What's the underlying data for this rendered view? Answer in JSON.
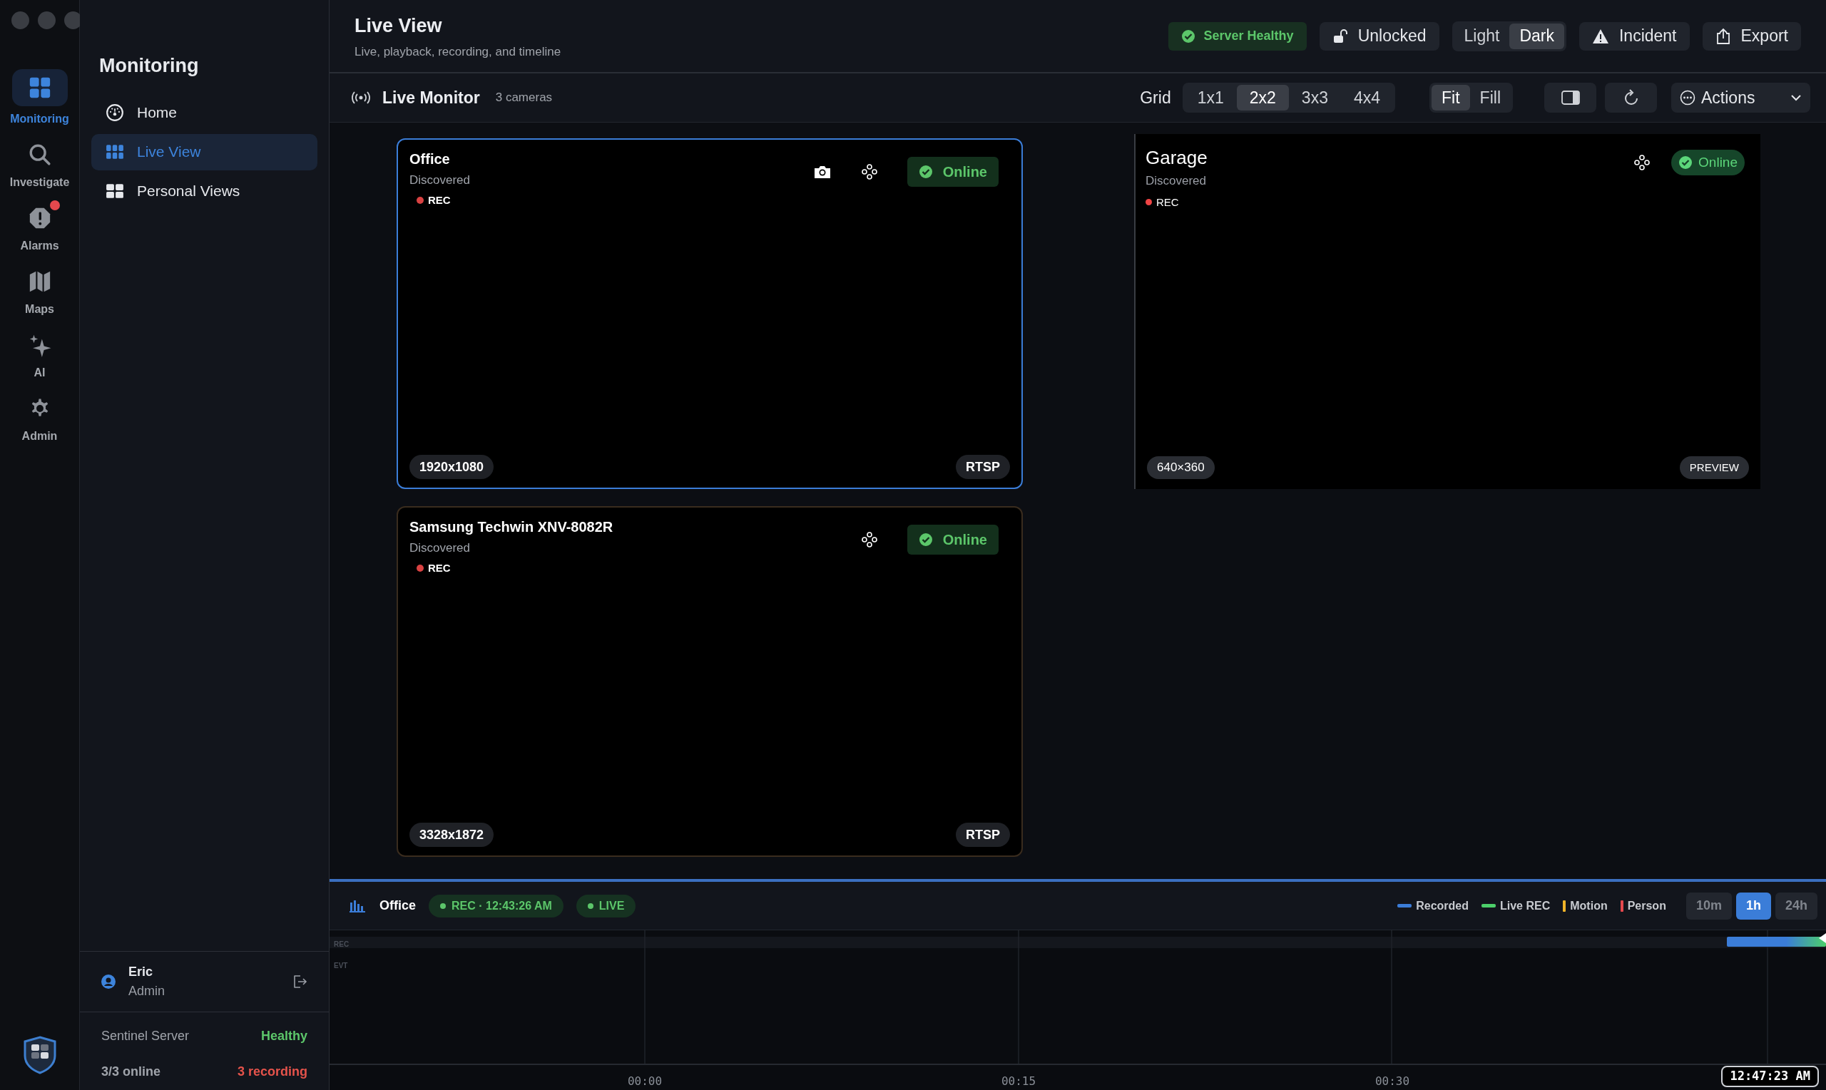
{
  "rail": [
    {
      "label": "Monitoring",
      "selected": true,
      "badge": false
    },
    {
      "label": "Investigate",
      "selected": false,
      "badge": false
    },
    {
      "label": "Alarms",
      "selected": false,
      "badge": true
    },
    {
      "label": "Maps",
      "selected": false,
      "badge": false
    },
    {
      "label": "AI",
      "selected": false,
      "badge": false
    },
    {
      "label": "Admin",
      "selected": false,
      "badge": false
    }
  ],
  "sidebar": {
    "title": "Monitoring",
    "items": [
      {
        "label": "Home",
        "selected": false
      },
      {
        "label": "Live View",
        "selected": true
      },
      {
        "label": "Personal Views",
        "selected": false
      }
    ],
    "user": {
      "name": "Eric",
      "role": "Admin"
    },
    "server": {
      "name": "Sentinel Server",
      "health": "Healthy",
      "online": "3/3 online",
      "recording": "3 recording"
    }
  },
  "header": {
    "title": "Live View",
    "subtitle": "Live, playback, recording, and timeline",
    "status": "Server Healthy",
    "lock": "Unlocked",
    "theme": [
      {
        "label": "Light",
        "selected": false
      },
      {
        "label": "Dark",
        "selected": true
      }
    ],
    "incident": "Incident",
    "export": "Export"
  },
  "toolbar": {
    "title": "Live Monitor",
    "count": "3 cameras",
    "grid_label": "Grid",
    "grid": [
      {
        "label": "1x1",
        "selected": false
      },
      {
        "label": "2x2",
        "selected": true
      },
      {
        "label": "3x3",
        "selected": false
      },
      {
        "label": "4x4",
        "selected": false
      }
    ],
    "fit": [
      {
        "label": "Fit",
        "selected": true
      },
      {
        "label": "Fill",
        "selected": false
      }
    ],
    "actions": "Actions"
  },
  "cameras": [
    {
      "kind": "tile",
      "name": "Office",
      "status": "Discovered",
      "rec": "REC",
      "online": "Online",
      "resolution": "1920x1080",
      "protocol": "RTSP",
      "selected": true,
      "snapshot": true
    },
    {
      "kind": "preview",
      "name": "Garage",
      "status": "Discovered",
      "rec": "REC",
      "online": "Online",
      "resolution": "640×360",
      "protocol": "PREVIEW",
      "selected": false
    },
    {
      "kind": "tile",
      "name": "Samsung Techwin XNV-8082R",
      "status": "Discovered",
      "rec": "REC",
      "online": "Online",
      "resolution": "3328x1872",
      "protocol": "RTSP",
      "selected": false,
      "snapshot": false
    }
  ],
  "timeline": {
    "camera": "Office",
    "rec_badge": "REC · 12:43:26 AM",
    "live_badge": "LIVE",
    "legend": [
      {
        "label": "Recorded",
        "color": "#3b7dd8",
        "kind": "bar"
      },
      {
        "label": "Live REC",
        "color": "#4ccf6a",
        "kind": "bar"
      },
      {
        "label": "Motion",
        "color": "#f0b429",
        "kind": "tick"
      },
      {
        "label": "Person",
        "color": "#e5484d",
        "kind": "tick"
      }
    ],
    "ranges": [
      {
        "label": "10m",
        "selected": false
      },
      {
        "label": "1h",
        "selected": true
      },
      {
        "label": "24h",
        "selected": false
      }
    ],
    "tracks": [
      "REC",
      "EVT"
    ],
    "ticks": [
      "00:00",
      "00:15",
      "00:30"
    ],
    "now": "12:47:23 AM"
  }
}
